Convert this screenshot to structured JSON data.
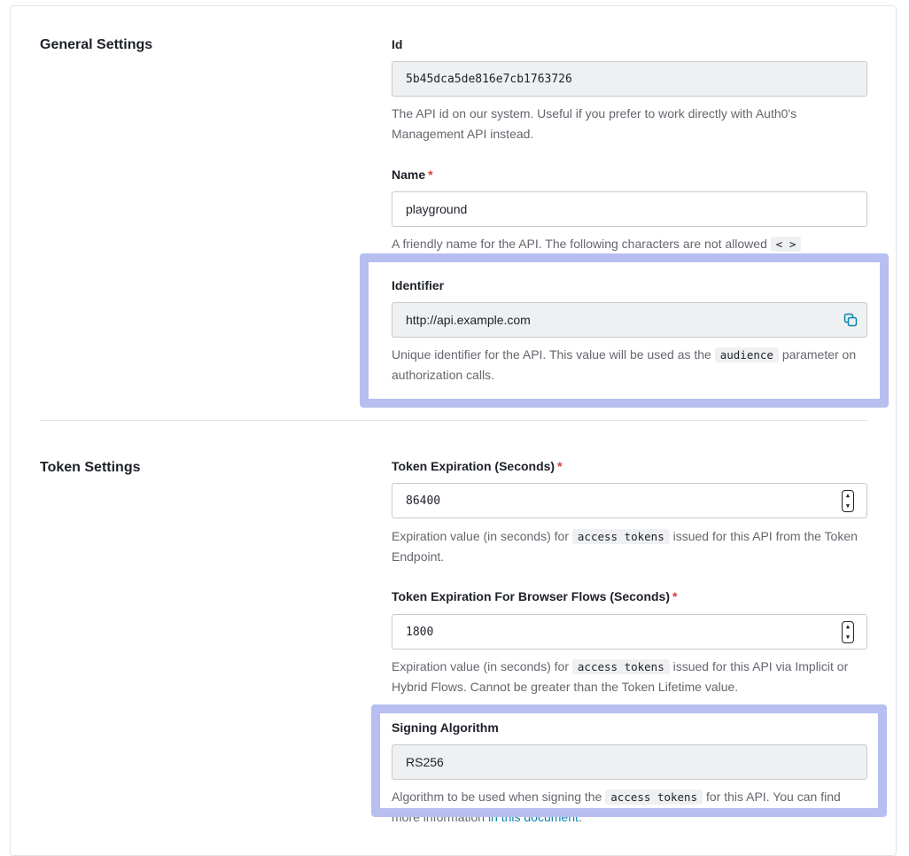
{
  "general": {
    "title": "General Settings",
    "id": {
      "label": "Id",
      "value": "5b45dca5de816e7cb1763726",
      "help": "The API id on our system. Useful if you prefer to work directly with Auth0's Management API instead."
    },
    "name": {
      "label": "Name",
      "required_mark": "*",
      "value": "playground",
      "help_prefix": "A friendly name for the API. The following characters are not allowed",
      "help_code": "< >"
    },
    "identifier": {
      "label": "Identifier",
      "value": "http://api.example.com",
      "help_prefix": "Unique identifier for the API. This value will be used as the",
      "help_code": "audience",
      "help_suffix": "parameter on authorization calls."
    }
  },
  "token": {
    "title": "Token Settings",
    "expiration": {
      "label": "Token Expiration (Seconds)",
      "required_mark": "*",
      "value": "86400",
      "help_prefix": "Expiration value (in seconds) for",
      "help_code": "access tokens",
      "help_suffix": "issued for this API from the Token Endpoint."
    },
    "browser_expiration": {
      "label": "Token Expiration For Browser Flows (Seconds)",
      "required_mark": "*",
      "value": "1800",
      "help_prefix": "Expiration value (in seconds) for",
      "help_code": "access tokens",
      "help_suffix": "issued for this API via Implicit or Hybrid Flows. Cannot be greater than the Token Lifetime value."
    },
    "signing": {
      "label": "Signing Algorithm",
      "value": "RS256",
      "help_prefix": "Algorithm to be used when signing the",
      "help_code": "access tokens",
      "help_middle": "for this API. You can find more information",
      "help_link": "in this document",
      "help_suffix": "."
    }
  },
  "icons": {
    "copy": "copy-icon",
    "stepper_up": "chevron-up-icon",
    "stepper_down": "chevron-down-icon"
  },
  "colors": {
    "highlight": "#b7bff0",
    "link": "#0a84ae",
    "required": "#d03c38"
  }
}
